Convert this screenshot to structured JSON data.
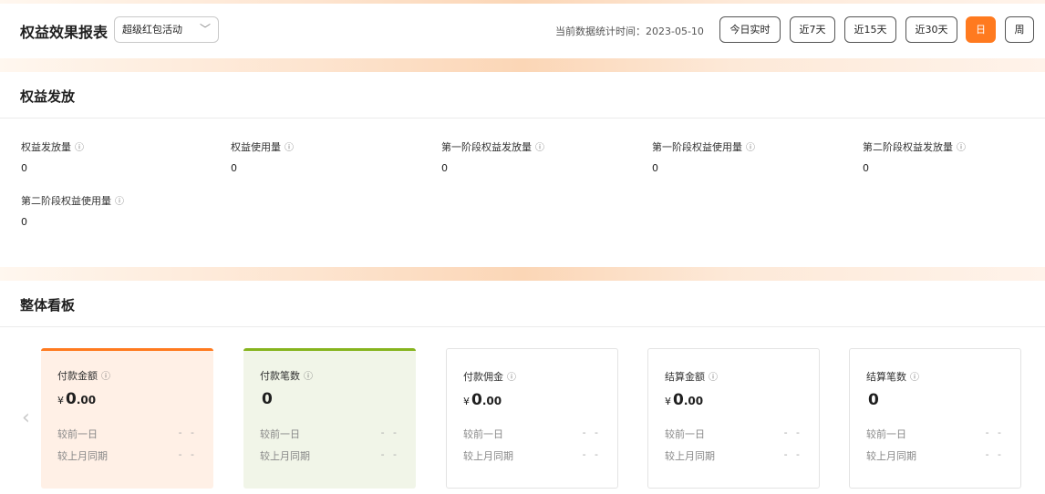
{
  "header": {
    "title": "权益效果报表",
    "activity_select": "超级红包活动",
    "stat_time": "当前数据统计时间：2023-05-10",
    "ranges": [
      "今日实时",
      "近7天",
      "近15天",
      "近30天",
      "日",
      "周"
    ],
    "active_range": "日",
    "accent_color": "#ff7a1f"
  },
  "equity": {
    "title": "权益发放",
    "metrics": [
      {
        "label": "权益发放量",
        "value": "0"
      },
      {
        "label": "权益使用量",
        "value": "0"
      },
      {
        "label": "第一阶段权益发放量",
        "value": "0"
      },
      {
        "label": "第一阶段权益使用量",
        "value": "0"
      },
      {
        "label": "第二阶段权益发放量",
        "value": "0"
      },
      {
        "label": "第二阶段权益使用量",
        "value": "0"
      }
    ]
  },
  "overview": {
    "title": "整体看板",
    "compare_prev_day": "较前一日",
    "compare_last_month": "较上月同期",
    "dash": "- -",
    "cards": [
      {
        "label": "付款金额",
        "currency": "¥",
        "int": "0",
        "dec": ".00",
        "theme": "orange"
      },
      {
        "label": "付款笔数",
        "currency": "",
        "int": "0",
        "dec": "",
        "theme": "green"
      },
      {
        "label": "付款佣金",
        "currency": "¥",
        "int": "0",
        "dec": ".00",
        "theme": "plain"
      },
      {
        "label": "结算金额",
        "currency": "¥",
        "int": "0",
        "dec": ".00",
        "theme": "plain"
      },
      {
        "label": "结算笔数",
        "currency": "",
        "int": "0",
        "dec": "",
        "theme": "plain"
      }
    ]
  },
  "icons": {
    "info": "info-icon",
    "select_arrow": "chevron-down-icon",
    "carousel_prev": "chevron-left-icon"
  }
}
